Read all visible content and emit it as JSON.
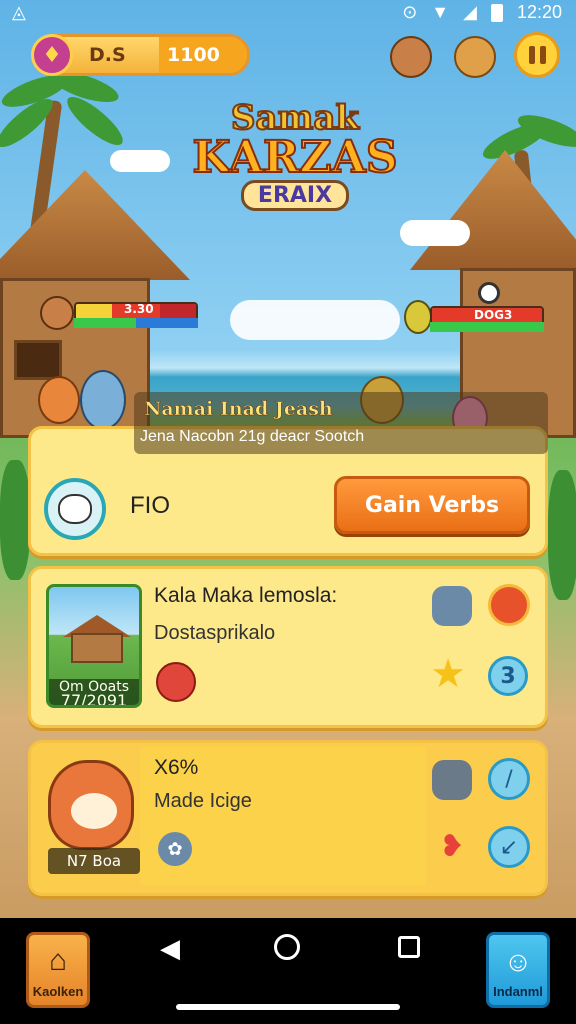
{
  "status_bar": {
    "time": "12:20"
  },
  "hud": {
    "currency_left": "D.S",
    "currency_right": "1100",
    "pause_label": "Pause"
  },
  "logo": {
    "line1": "Samak",
    "line2": "KARZAS",
    "line3": "ERAIX"
  },
  "healthbars": {
    "left_label": "3.30",
    "right_label": "DOG3"
  },
  "banner": {
    "title": "Namai Inad Jeash",
    "subtitle": "Jena Nacobn 21g deacr Sootch"
  },
  "card_player": {
    "name": "FIO",
    "button_label": "Gain Verbs"
  },
  "card_quest": {
    "thumb_caption_top": "Om Ooats",
    "thumb_caption_bottom": "77/2091",
    "title": "Kala Maka lemosla:",
    "subtitle": "Dostasprikalo",
    "badge_number": "3"
  },
  "card_pet": {
    "caption": "N7 Boa",
    "title": "X6%",
    "subtitle": "Made Icige"
  },
  "bottom_nav": {
    "left_label": "Kaolken",
    "right_label": "Indanml"
  },
  "colors": {
    "accent_orange": "#ea6f16",
    "card_yellow": "#fde88a",
    "card_gold": "#fccd4c",
    "teal": "#2aa7b5",
    "nav_blue": "#1f9ad8"
  }
}
